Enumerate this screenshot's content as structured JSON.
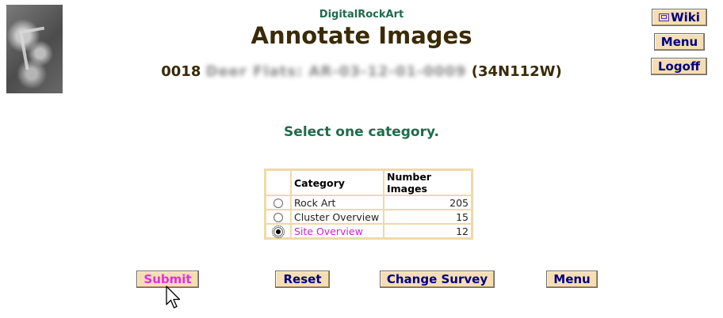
{
  "header": {
    "brand": "DigitalRockArt",
    "title": "Annotate Images",
    "subtitle_prefix": "0018",
    "subtitle_blurred": "Deer Flats: AR-03-12-01-0009",
    "subtitle_suffix": "(34N112W)"
  },
  "top_buttons": {
    "wiki": "Wiki",
    "menu": "Menu",
    "logoff": "Logoff"
  },
  "prompt": "Select one category.",
  "table": {
    "headers": [
      "Category",
      "Number Images"
    ],
    "rows": [
      {
        "category": "Rock Art",
        "count": "205",
        "selected": false
      },
      {
        "category": "Cluster Overview",
        "count": "15",
        "selected": false
      },
      {
        "category": "Site Overview",
        "count": "12",
        "selected": true
      }
    ]
  },
  "bottom_buttons": {
    "submit": "Submit",
    "reset": "Reset",
    "change_survey": "Change Survey",
    "menu": "Menu"
  },
  "colors": {
    "button_bg": "#f5deb3",
    "button_text": "#000080",
    "brand_green": "#1f6b4c",
    "title_brown": "#3a2a06",
    "selected_magenta": "#d21ed2"
  },
  "icons": {
    "wiki": "external-window-icon",
    "cursor": "mouse-pointer-icon"
  }
}
